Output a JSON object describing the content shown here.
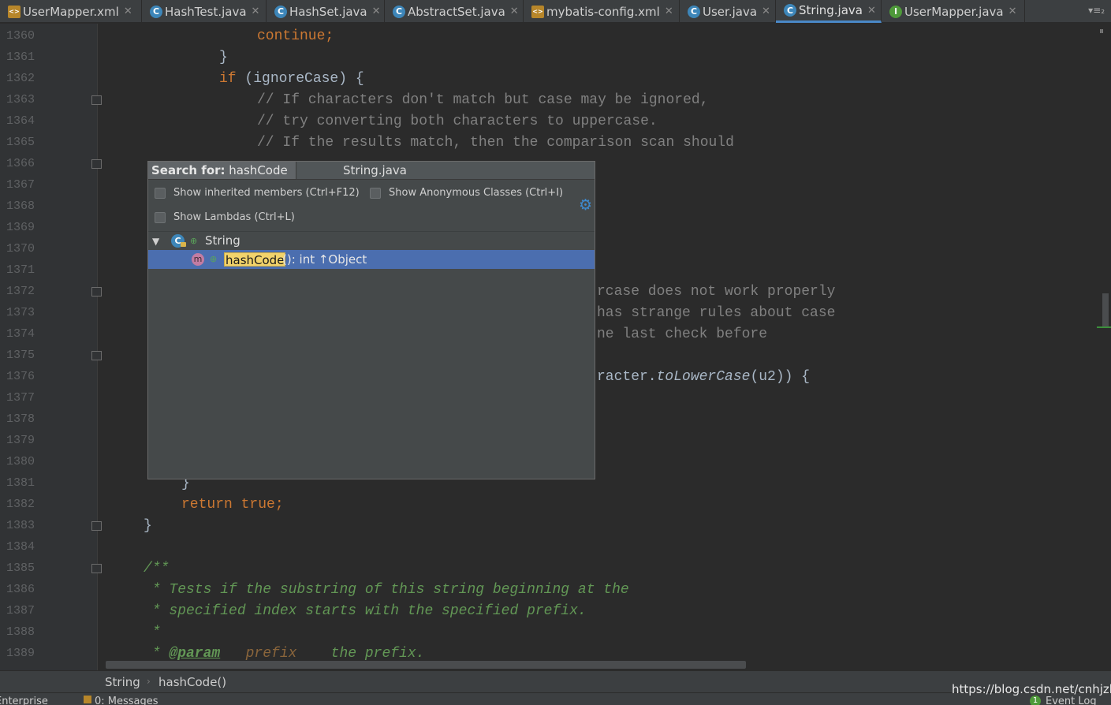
{
  "tabs": [
    {
      "label": "UserMapper.xml",
      "icon": "xml-file-icon",
      "glyph": "<>"
    },
    {
      "label": "HashTest.java",
      "icon": "class-file-icon",
      "glyph": "C"
    },
    {
      "label": "HashSet.java",
      "icon": "class-file-icon",
      "glyph": "C"
    },
    {
      "label": "AbstractSet.java",
      "icon": "class-file-icon",
      "glyph": "C"
    },
    {
      "label": "mybatis-config.xml",
      "icon": "xml-file-icon",
      "glyph": "<>"
    },
    {
      "label": "User.java",
      "icon": "class-file-icon",
      "glyph": "C"
    },
    {
      "label": "String.java",
      "icon": "class-file-icon",
      "glyph": "C",
      "active": true
    },
    {
      "label": "UserMapper.java",
      "icon": "interface-file-icon",
      "glyph": "I"
    }
  ],
  "tab_close_glyph": "✕",
  "tab_menu_glyph": "▾≡₂",
  "line_numbers": [
    "1360",
    "1361",
    "1362",
    "1363",
    "1364",
    "1365",
    "1366",
    "1367",
    "1368",
    "1369",
    "1370",
    "1371",
    "1372",
    "1373",
    "1374",
    "1375",
    "1376",
    "1377",
    "1378",
    "1379",
    "1380",
    "1381",
    "1382",
    "1383",
    "1384",
    "1385",
    "1386",
    "1387",
    "1388",
    "1389"
  ],
  "code": {
    "l1360_kw": "continue;",
    "l1361": "}",
    "l1362_kw": "if",
    "l1362_rest": " (ignoreCase) {",
    "l1363": "// If characters don't match but case may be ignored,",
    "l1364": "// try converting both characters to uppercase.",
    "l1365": "// If the results match, then the comparison scan should",
    "l1372": "rcase does not work properly",
    "l1373": "has strange rules about case",
    "l1374": "ne last check before",
    "l1376_a": "racter.",
    "l1376_b": "toLowerCase",
    "l1376_c": "(u2)) {",
    "l1381": "}",
    "l1382_kw": "return true;",
    "l1383": "}",
    "l1385": "/**",
    "l1386": " * Tests if the substring of this string beginning at the",
    "l1387": " * specified index starts with the specified prefix.",
    "l1388": " *",
    "l1389_a": " * ",
    "l1389_tag": "@param",
    "l1389_par": "prefix",
    "l1389_rest": "    the prefix."
  },
  "popup": {
    "search_label": "Search for:",
    "search_value": "hashCode",
    "title": "String.java",
    "options": [
      {
        "label": "Show inherited members (Ctrl+F12)",
        "checked": false
      },
      {
        "label": "Show Anonymous Classes (Ctrl+I)",
        "checked": false
      },
      {
        "label": "Show Lambdas (Ctrl+L)",
        "checked": false
      }
    ],
    "tree_root": "String",
    "tree_root_glyph": "C",
    "member_glyph": "m",
    "member_name": "hashCode",
    "member_signature": "(): int ↑Object"
  },
  "breadcrumb": {
    "class_name": "String",
    "separator": "›",
    "method": "hashCode()"
  },
  "statusbar": {
    "left": "Enterprise",
    "messages": "0: Messages",
    "event_log": "Event Log",
    "event_count": "1"
  },
  "watermark": "https://blog.csdn.net/cnhjzb",
  "colors": {
    "keyword": "#cc7832",
    "comment": "#808080",
    "doc": "#629755",
    "selection": "#4b6eaf",
    "match_highlight": "#f2d36b"
  }
}
